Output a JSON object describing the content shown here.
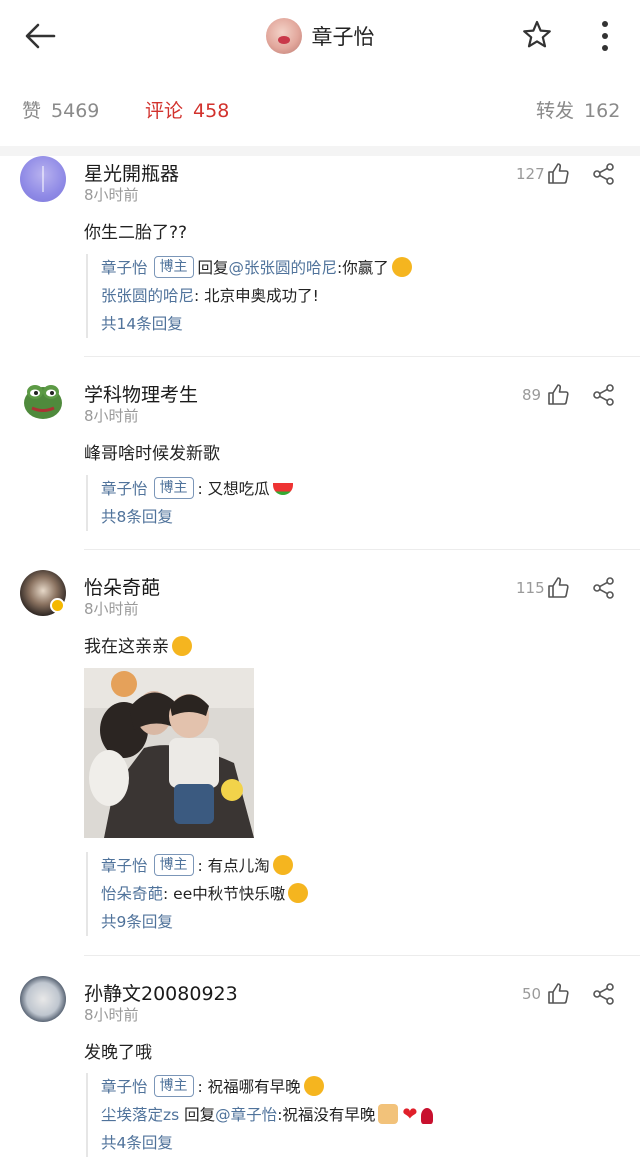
{
  "header": {
    "title": "章子怡"
  },
  "stats": {
    "likes_label": "赞",
    "likes_count": "5469",
    "comments_label": "评论",
    "comments_count": "458",
    "reposts_label": "转发",
    "reposts_count": "162"
  },
  "comments": [
    {
      "user": "星光開瓶器",
      "time": "8小时前",
      "likes": "127",
      "text": "你生二胎了??",
      "replies": [
        {
          "user": "章子怡",
          "tag": "博主",
          "prefix": "回复",
          "mention": "@张张圆的哈尼",
          "text": ":你赢了"
        },
        {
          "user": "张张圆的哈尼",
          "text": ": 北京申奥成功了!"
        }
      ],
      "more": "共14条回复"
    },
    {
      "user": "学科物理考生",
      "time": "8小时前",
      "likes": "89",
      "text": "峰哥啥时候发新歌",
      "replies": [
        {
          "user": "章子怡",
          "tag": "博主",
          "text": ": 又想吃瓜"
        }
      ],
      "more": "共8条回复"
    },
    {
      "user": "怡朵奇葩",
      "time": "8小时前",
      "likes": "115",
      "text": "我在这亲亲",
      "replies": [
        {
          "user": "章子怡",
          "tag": "博主",
          "text": ": 有点儿淘"
        },
        {
          "user": "怡朵奇葩",
          "text": ": ee中秋节快乐嗷"
        }
      ],
      "more": "共9条回复"
    },
    {
      "user": "孙静文20080923",
      "time": "8小时前",
      "likes": "50",
      "text": "发晚了哦",
      "replies": [
        {
          "user": "章子怡",
          "tag": "博主",
          "text": ": 祝福哪有早晚"
        },
        {
          "user": "尘埃落定zs",
          "prefix": "回复",
          "mention": "@章子怡",
          "text": ":祝福没有早晚"
        }
      ],
      "more": "共4条回复"
    }
  ],
  "icons": {
    "back": "arrow-left-icon",
    "star": "star-icon",
    "more": "more-vertical-icon",
    "like": "thumb-up-icon",
    "share": "share-icon"
  },
  "colors": {
    "accent": "#d2322d",
    "link": "#50739b",
    "muted": "#9a9a9a"
  }
}
